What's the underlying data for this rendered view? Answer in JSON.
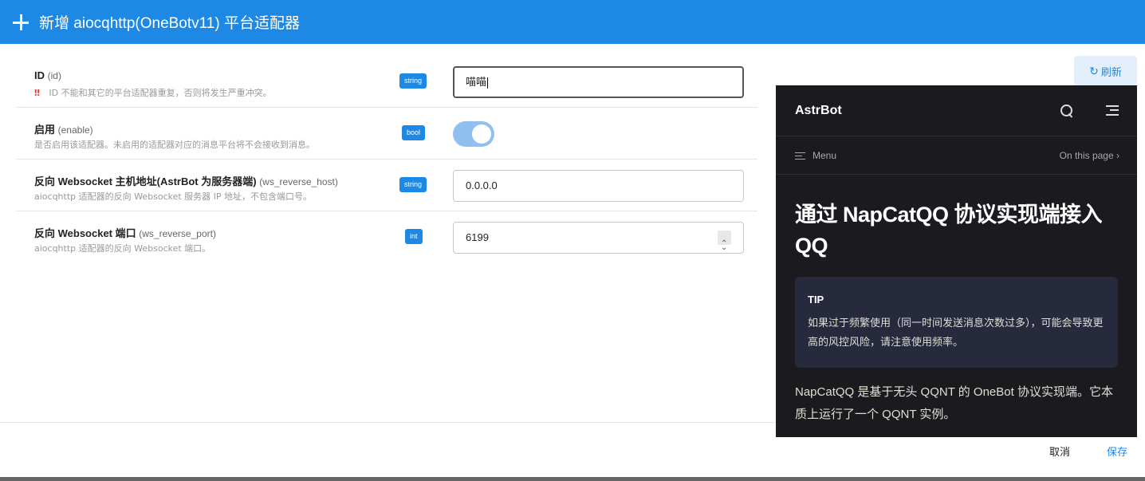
{
  "dialog": {
    "title": "新增 aiocqhttp(OneBotv11) 平台适配器",
    "refresh_label": "刷新",
    "cancel_label": "取消",
    "save_label": "保存"
  },
  "fields": [
    {
      "label": "ID",
      "key": "(id)",
      "desc": "ID 不能和其它的平台适配器重复，否则将发生严重冲突。",
      "desc_prefix": "‼",
      "type": "string",
      "value": "喵喵"
    },
    {
      "label": "启用",
      "key": "(enable)",
      "desc": "是否启用该适配器。未启用的适配器对应的消息平台将不会接收到消息。",
      "type": "bool",
      "value": "true"
    },
    {
      "label": "反向 Websocket 主机地址(AstrBot 为服务器端)",
      "key": "(ws_reverse_host)",
      "desc": "aiocqhttp 适配器的反向 Websocket 服务器 IP 地址，不包含端口号。",
      "type": "string",
      "value": "0.0.0.0"
    },
    {
      "label": "反向 Websocket 端口",
      "key": "(ws_reverse_port)",
      "desc": "aiocqhttp 适配器的反向 Websocket 端口。",
      "type": "int",
      "value": "6199"
    }
  ],
  "docs": {
    "brand": "AstrBot",
    "menu_label": "Menu",
    "on_this_page": "On this page",
    "heading": "通过 NapCatQQ 协议实现端接入 QQ",
    "tip_title": "TIP",
    "tip_text": "如果过于频繁使用（同一时间发送消息次数过多），可能会导致更高的风控风险，请注意使用频率。",
    "paragraph": "NapCatQQ 是基于无头 QQNT 的 OneBot 协议实现端。它本质上运行了一个 QQNT 实例。"
  },
  "colors": {
    "primary": "#1e88e5",
    "docs_bg": "#1b1b1f",
    "tip_bg": "#272a3d"
  }
}
